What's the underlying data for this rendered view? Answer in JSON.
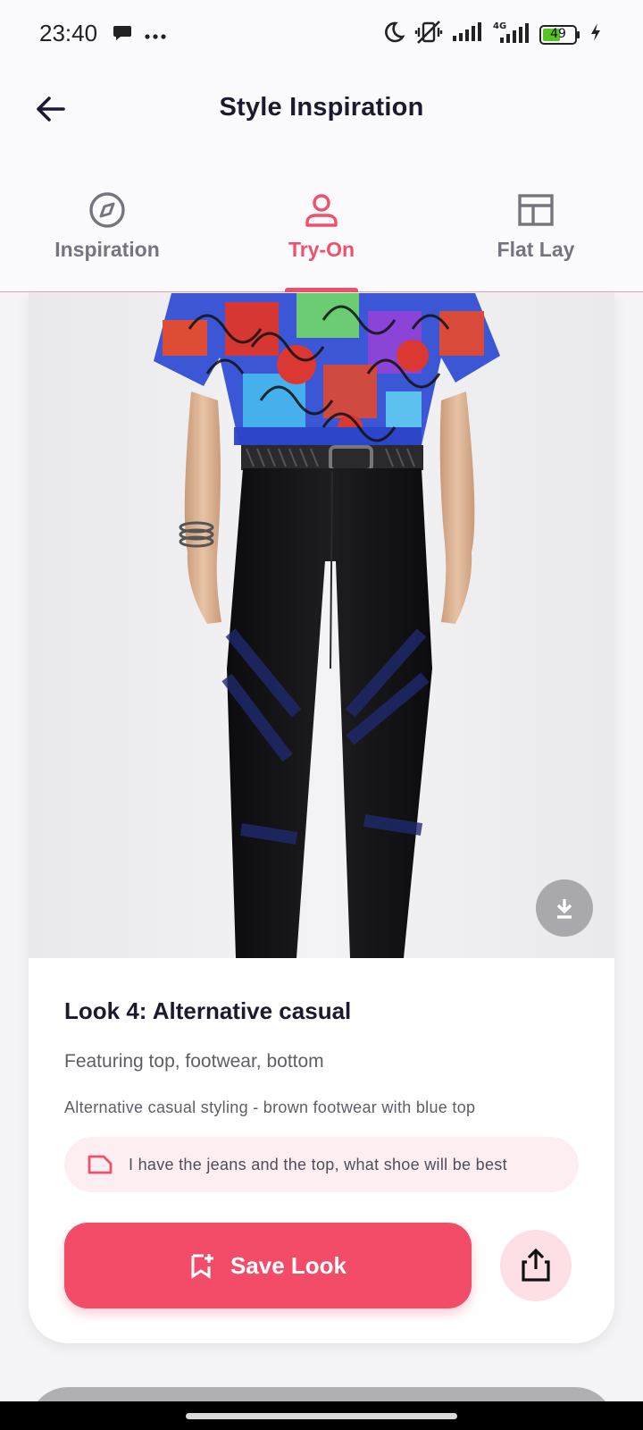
{
  "status_bar": {
    "time": "23:40",
    "battery_level": "49",
    "icons": [
      "chat-bubble-icon",
      "more-dots-icon",
      "moon-icon",
      "vibrate-off-icon",
      "signal-icon",
      "signal-4g-icon",
      "battery-icon",
      "charging-icon"
    ]
  },
  "header": {
    "title": "Style Inspiration"
  },
  "tabs": [
    {
      "label": "Inspiration",
      "icon": "compass-icon",
      "active": false
    },
    {
      "label": "Try-On",
      "icon": "person-icon",
      "active": true
    },
    {
      "label": "Flat Lay",
      "icon": "layout-icon",
      "active": false
    }
  ],
  "colors": {
    "accent": "#f0506b",
    "save_button": "#f34c69",
    "prompt_bg": "#fdeff1"
  },
  "look": {
    "title": "Look 4: Alternative casual",
    "featuring": "Featuring top, footwear, bottom",
    "description": "Alternative casual styling - brown footwear with blue top",
    "prompt": "I have the jeans and the top, what shoe will be best",
    "save_label": "Save Look"
  }
}
